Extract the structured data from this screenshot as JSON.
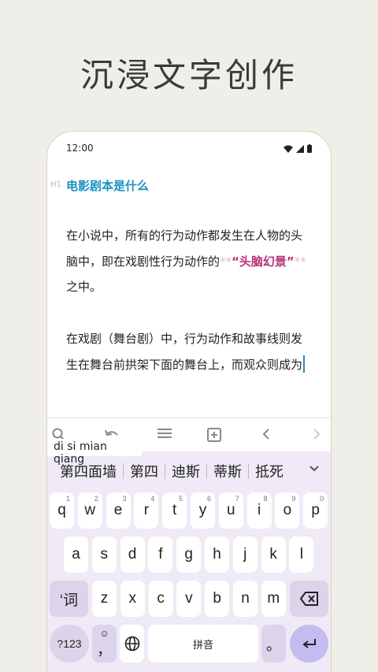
{
  "headline": "沉浸文字创作",
  "status": {
    "time": "12:00"
  },
  "editor": {
    "h1_tag": "H1",
    "heading": "电影剧本是什么",
    "p1_a": "在小说中，所有的行为动作都发生在人物的头脑中，即在戏剧性行为动作的",
    "p1_mark_open": "**",
    "p1_highlight": "“头脑幻景”",
    "p1_mark_close": "**",
    "p1_end": "之中。",
    "p2": "在戏剧（舞台剧）中，行为动作和故事线则发生在舞台前拱架下面的舞台上，而观众则成为"
  },
  "toolbar": {
    "icons": [
      "search-icon",
      "undo-icon",
      "list-icon",
      "add-box-icon",
      "chevron-left-icon",
      "chevron-right-icon"
    ]
  },
  "keyboard": {
    "pinyin": "di si mian qiang",
    "candidates": [
      "第四面墙",
      "第四",
      "迪斯",
      "蒂斯",
      "抵死"
    ],
    "row1": [
      {
        "k": "q",
        "n": "1"
      },
      {
        "k": "w",
        "n": "2"
      },
      {
        "k": "e",
        "n": "3"
      },
      {
        "k": "r",
        "n": "4"
      },
      {
        "k": "t",
        "n": "5"
      },
      {
        "k": "y",
        "n": "6"
      },
      {
        "k": "u",
        "n": "7"
      },
      {
        "k": "i",
        "n": "8"
      },
      {
        "k": "o",
        "n": "9"
      },
      {
        "k": "p",
        "n": "0"
      }
    ],
    "row2": [
      "a",
      "s",
      "d",
      "f",
      "g",
      "h",
      "j",
      "k",
      "l"
    ],
    "row3": [
      "z",
      "x",
      "c",
      "v",
      "b",
      "n",
      "m"
    ],
    "word_key": "‘词",
    "sym_key": "?123",
    "emoji_comma": "，",
    "space_label": "拼音",
    "period": "。"
  },
  "colors": {
    "heading": "#1a8fc4",
    "highlight": "#b7327a",
    "keyboard_bg": "#efeaf6",
    "enter": "#c4bbf1"
  }
}
